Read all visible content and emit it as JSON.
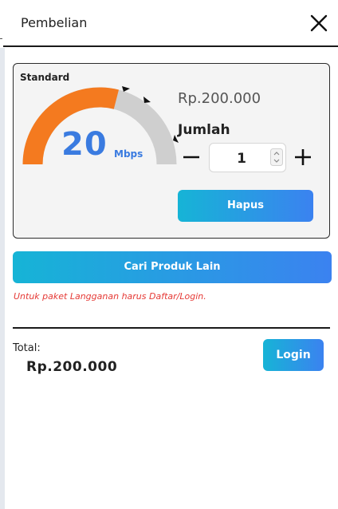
{
  "header": {
    "title": "Pembelian",
    "close_icon": "close-icon"
  },
  "product": {
    "plan": "Standard",
    "speed_value": "20",
    "speed_unit": "Mbps",
    "gauge_level": 0.58,
    "price": "Rp.200.000",
    "quantity_label": "Jumlah",
    "quantity": "1",
    "remove_label": "Hapus",
    "icons": [
      "minus-icon",
      "plus-icon",
      "stepper-up-icon",
      "stepper-down-icon"
    ]
  },
  "actions": {
    "find_other_label": "Cari Produk Lain"
  },
  "notice": "Untuk paket Langganan harus Daftar/Login.",
  "summary": {
    "total_label": "Total:",
    "total_value": "Rp.200.000",
    "login_label": "Login"
  },
  "colors": {
    "gauge_fill": "#f47a1f",
    "gauge_track": "#cfcfcf",
    "speed_text": "#3a7be0",
    "button_gradient_start": "#16b4d6",
    "button_gradient_end": "#3b82f0",
    "notice_text": "#e53935"
  }
}
